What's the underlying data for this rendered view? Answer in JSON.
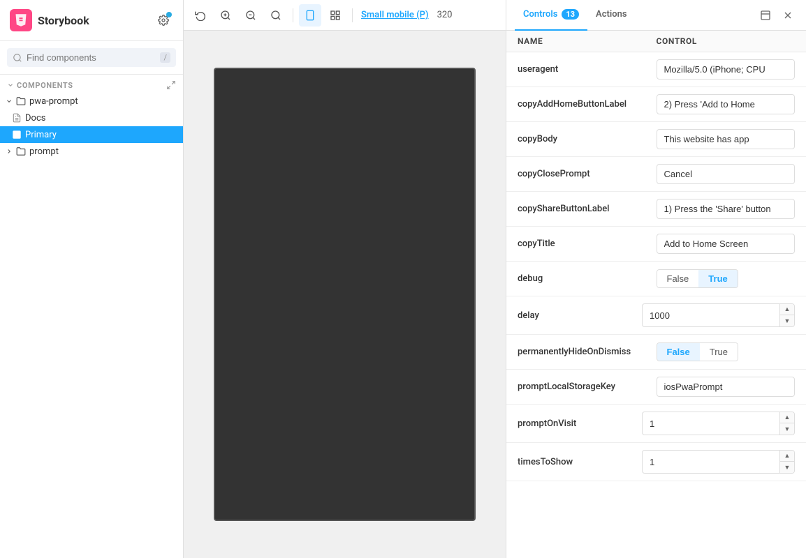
{
  "sidebar": {
    "title": "Storybook",
    "search_placeholder": "Find components",
    "search_shortcut": "/",
    "components_label": "COMPONENTS",
    "tree": [
      {
        "id": "pwa-prompt",
        "label": "pwa-prompt",
        "level": 0,
        "type": "folder",
        "expanded": true
      },
      {
        "id": "docs",
        "label": "Docs",
        "level": 1,
        "type": "doc",
        "expanded": false
      },
      {
        "id": "primary",
        "label": "Primary",
        "level": 1,
        "type": "story",
        "expanded": false,
        "selected": true
      },
      {
        "id": "prompt",
        "label": "prompt",
        "level": 0,
        "type": "folder",
        "expanded": false
      }
    ]
  },
  "canvas": {
    "viewport_label": "Small mobile (P)",
    "viewport_size": "320",
    "toolbar": {
      "refresh": "↺",
      "zoom_in": "+",
      "zoom_out": "−",
      "zoom_reset": "⊙"
    }
  },
  "panel": {
    "tabs": [
      {
        "id": "controls",
        "label": "Controls",
        "badge": "13",
        "active": true
      },
      {
        "id": "actions",
        "label": "Actions",
        "badge": null,
        "active": false
      }
    ],
    "header": {
      "name_col": "Name",
      "control_col": "Control"
    },
    "controls": [
      {
        "name": "useragent",
        "type": "text",
        "value": "Mozilla/5.0 (iPhone; CPU"
      },
      {
        "name": "copyAddHomeButtonLabel",
        "type": "text",
        "value": "2) Press 'Add to Home"
      },
      {
        "name": "copyBody",
        "type": "text",
        "value": "This website has app"
      },
      {
        "name": "copyClosePrompt",
        "type": "text",
        "value": "Cancel"
      },
      {
        "name": "copyShareButtonLabel",
        "type": "text",
        "value": "1) Press the 'Share' button"
      },
      {
        "name": "copyTitle",
        "type": "text",
        "value": "Add to Home Screen"
      },
      {
        "name": "debug",
        "type": "toggle",
        "options": [
          "False",
          "True"
        ],
        "value": "True"
      },
      {
        "name": "delay",
        "type": "number",
        "value": "1000"
      },
      {
        "name": "permanentlyHideOnDismiss",
        "type": "toggle",
        "options": [
          "False",
          "True"
        ],
        "value": "False"
      },
      {
        "name": "promptLocalStorageKey",
        "type": "text",
        "value": "iosPwaPrompt"
      },
      {
        "name": "promptOnVisit",
        "type": "number",
        "value": "1"
      },
      {
        "name": "timesToShow",
        "type": "number",
        "value": "1"
      }
    ]
  }
}
